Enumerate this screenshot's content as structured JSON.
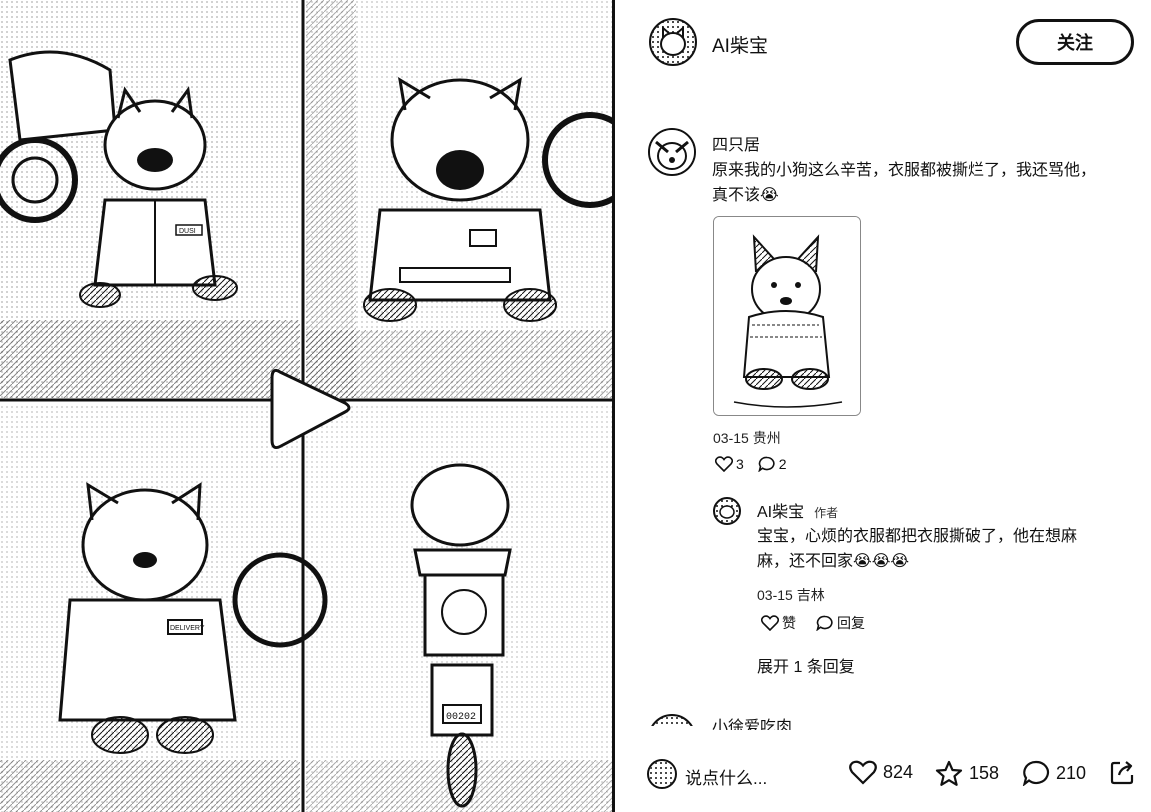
{
  "media": {
    "video_play_label": "",
    "shirt_badges": [
      "DUSI",
      "DELIVERY"
    ],
    "plate_number": "00202"
  },
  "author": {
    "name": "AI柴宝",
    "follow_label": "关注"
  },
  "comments": [
    {
      "user": "四只居",
      "text_line1": "原来我的小狗这么辛苦，衣服都被撕烂了，我还骂他，",
      "text_line2": "真不该",
      "emoji": "😭",
      "date": "03-15",
      "location": "贵州",
      "likes": "3",
      "replies": "2",
      "sub_replies": [
        {
          "user": "AI柴宝",
          "author_tag": "作者",
          "text_line1": "宝宝，心烦的衣服都把衣服撕破了，他在想麻",
          "text_line2": "麻，还不回家",
          "emojis": "😭😭😭",
          "date": "03-15",
          "location": "吉林",
          "like_label": "赞",
          "reply_label": "回复"
        }
      ],
      "expand_label": "展开 1 条回复"
    },
    {
      "user": "小徐爱吃肉"
    }
  ],
  "bottom_bar": {
    "input_placeholder": "说点什么...",
    "likes": "824",
    "stars": "158",
    "comments": "210"
  }
}
